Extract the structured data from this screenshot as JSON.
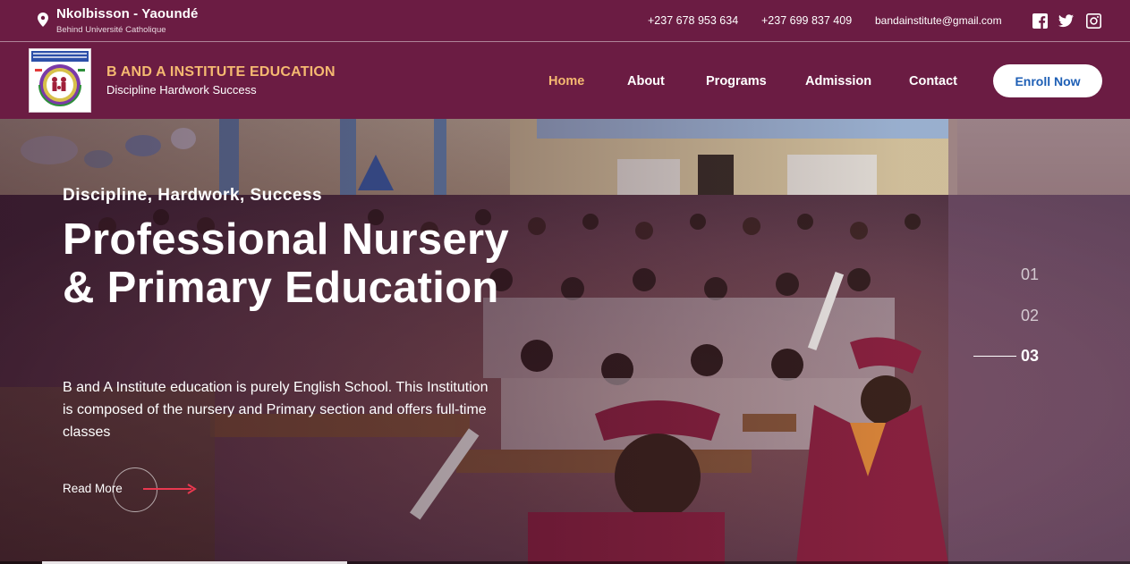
{
  "topbar": {
    "location_title": "Nkolbisson - Yaoundé",
    "location_sub": "Behind Université Catholique",
    "phone1": "+237 678 953 634",
    "phone2": "+237 699 837 409",
    "email": "bandainstitute@gmail.com",
    "social": [
      "facebook-icon",
      "twitter-icon",
      "instagram-icon"
    ]
  },
  "navbar": {
    "brand_name": "B AND A INSTITUTE EDUCATION",
    "brand_tagline": "Discipline Hardwork Success",
    "links": [
      {
        "label": "Home",
        "active": true
      },
      {
        "label": "About",
        "active": false
      },
      {
        "label": "Programs",
        "active": false
      },
      {
        "label": "Admission",
        "active": false
      },
      {
        "label": "Contact",
        "active": false
      }
    ],
    "cta_label": "Enroll Now"
  },
  "hero": {
    "eyebrow": "Discipline, Hardwork, Success",
    "title": "Professional Nursery & Primary Education",
    "description": "B and A Institute education is purely English School. This Institution is composed of the nursery and Primary section and offers full-time classes",
    "read_more": "Read More",
    "slides": [
      "01",
      "02",
      "03"
    ],
    "active_slide": "03",
    "slide_progress": 0.27
  },
  "colors": {
    "primary": "#6b1c43",
    "accent": "#f5b971",
    "cta_text": "#1e5fb5",
    "arrow": "#e8384f"
  }
}
